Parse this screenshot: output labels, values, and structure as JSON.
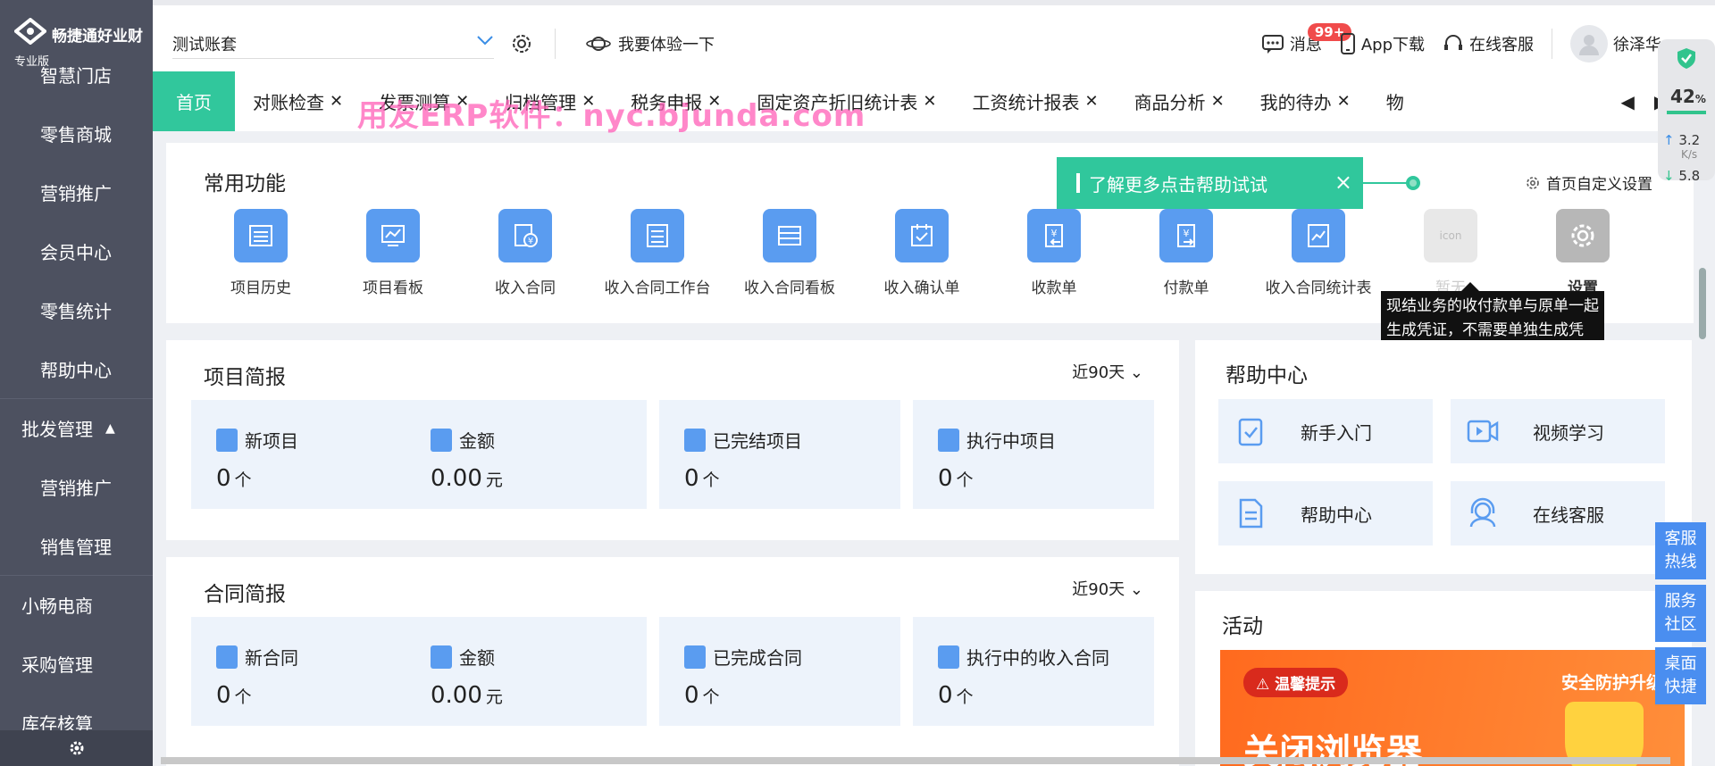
{
  "brand": {
    "name": "畅捷通好业财",
    "edition": "专业版"
  },
  "sidebar": {
    "items": [
      {
        "label": "智慧门店",
        "kind": "sub"
      },
      {
        "label": "零售商城",
        "kind": "sub"
      },
      {
        "label": "营销推广",
        "kind": "sub"
      },
      {
        "label": "会员中心",
        "kind": "sub"
      },
      {
        "label": "零售统计",
        "kind": "sub"
      },
      {
        "label": "帮助中心",
        "kind": "sub"
      },
      {
        "label": "批发管理",
        "kind": "group"
      },
      {
        "label": "营销推广",
        "kind": "sub"
      },
      {
        "label": "销售管理",
        "kind": "sub"
      },
      {
        "label": "小畅电商",
        "kind": "group"
      },
      {
        "label": "采购管理",
        "kind": "top"
      },
      {
        "label": "库存核算",
        "kind": "top"
      }
    ]
  },
  "header": {
    "account": "测试账套",
    "try_label": "我要体验一下",
    "messages": "消息",
    "badge": "99+",
    "app": "App下载",
    "service": "在线客服",
    "user": "徐泽华"
  },
  "tabs": [
    {
      "label": "首页",
      "active": true
    },
    {
      "label": "对账检查"
    },
    {
      "label": "发票测算"
    },
    {
      "label": "归档管理"
    },
    {
      "label": "税务申报"
    },
    {
      "label": "固定资产折旧统计表"
    },
    {
      "label": "工资统计报表"
    },
    {
      "label": "商品分析"
    },
    {
      "label": "我的待办"
    },
    {
      "label": "物"
    }
  ],
  "watermark": "用友ERP软件：nyc.bjunda.com",
  "common": {
    "title": "常用功能",
    "customize": "首页自定义设置",
    "functions": [
      "项目历史",
      "项目看板",
      "收入合同",
      "收入合同工作台",
      "收入合同看板",
      "收入确认单",
      "收款单",
      "付款单",
      "收入合同统计表",
      "暂无",
      "设置"
    ]
  },
  "guide": {
    "text": "了解更多点击帮助试试",
    "close": "×"
  },
  "tooltip": "现结业务的收付款单与原单一起生成凭证，不需要单独生成凭证。包括进货单、销货单、费用支出单、其他收入单的现结业务。",
  "project_brief": {
    "title": "项目简报",
    "range": "近90天",
    "stats": [
      {
        "label": "新项目",
        "value": "0",
        "unit": "个"
      },
      {
        "label": "金额",
        "value": "0.00",
        "unit": "元"
      },
      {
        "label": "已完结项目",
        "value": "0",
        "unit": "个"
      },
      {
        "label": "执行中项目",
        "value": "0",
        "unit": "个"
      }
    ]
  },
  "contract_brief": {
    "title": "合同简报",
    "range": "近90天",
    "stats": [
      {
        "label": "新合同",
        "value": "0",
        "unit": "个"
      },
      {
        "label": "金额",
        "value": "0.00",
        "unit": "元"
      },
      {
        "label": "已完成合同",
        "value": "0",
        "unit": "个"
      },
      {
        "label": "执行中的收入合同",
        "value": "0",
        "unit": "个"
      }
    ]
  },
  "help": {
    "title": "帮助中心",
    "items": [
      "新手入门",
      "视频学习",
      "帮助中心",
      "在线客服"
    ]
  },
  "activity": {
    "title": "活动",
    "tip": "温馨提示",
    "security": "安全防护升级",
    "headline": "关闭浏览器"
  },
  "side_service": [
    "客服热线",
    "服务社区",
    "桌面快捷"
  ],
  "speed": {
    "percent": "42",
    "up": "3.2",
    "down": "5.8",
    "unit": "K/s"
  },
  "colors": {
    "accent": "#31c79c",
    "sidebar": "#4d5160",
    "icon_blue": "#5a9cf0"
  }
}
